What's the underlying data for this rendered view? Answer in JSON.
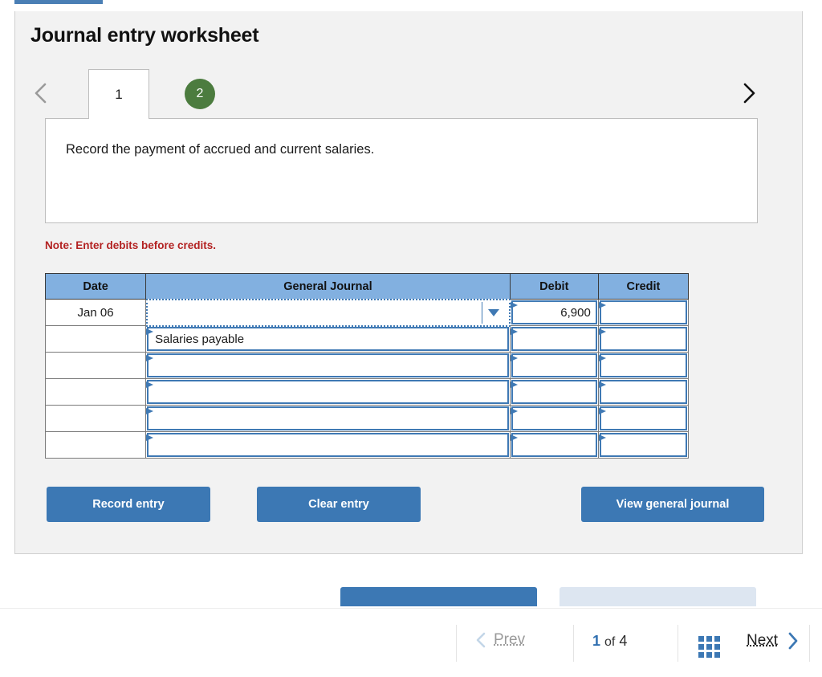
{
  "top_bar": {
    "color": "#4a7fb5"
  },
  "panel": {
    "title": "Journal entry worksheet",
    "background": "#f2f2f2"
  },
  "tabs": {
    "prev_arrow_icon": "chevron-left-icon",
    "next_arrow_icon": "chevron-right-icon",
    "items": [
      {
        "label": "1",
        "state": "active"
      },
      {
        "label": "2",
        "state": "badge",
        "color": "#4c7c3f"
      }
    ]
  },
  "prompt": {
    "text": "Record the payment of accrued and current salaries."
  },
  "note": {
    "text": "Note: Enter debits before credits.",
    "color": "#b32222"
  },
  "journal": {
    "headers": [
      "Date",
      "General Journal",
      "Debit",
      "Credit"
    ],
    "header_color": "#82b0e0",
    "rows": [
      {
        "date": "Jan 06",
        "account": "",
        "debit": "6,900",
        "credit": "",
        "active": true,
        "dropdown": true
      },
      {
        "date": "",
        "account": "Salaries payable",
        "debit": "",
        "credit": "",
        "active": false,
        "dropdown": false
      },
      {
        "date": "",
        "account": "",
        "debit": "",
        "credit": "",
        "active": false,
        "dropdown": false
      },
      {
        "date": "",
        "account": "",
        "debit": "",
        "credit": "",
        "active": false,
        "dropdown": false
      },
      {
        "date": "",
        "account": "",
        "debit": "",
        "credit": "",
        "active": false,
        "dropdown": false
      },
      {
        "date": "",
        "account": "",
        "debit": "",
        "credit": "",
        "active": false,
        "dropdown": false
      }
    ]
  },
  "actions": {
    "record_label": "Record entry",
    "clear_label": "Clear entry",
    "view_label": "View general journal",
    "accent": "#3c78b4"
  },
  "pager": {
    "prev_label": "Prev",
    "prev_icon": "chevron-left-icon",
    "current_page": "1",
    "of_label": "of",
    "total_pages": "4",
    "grid_icon": "grid-view-icon",
    "next_label": "Next",
    "next_icon": "chevron-right-icon"
  }
}
